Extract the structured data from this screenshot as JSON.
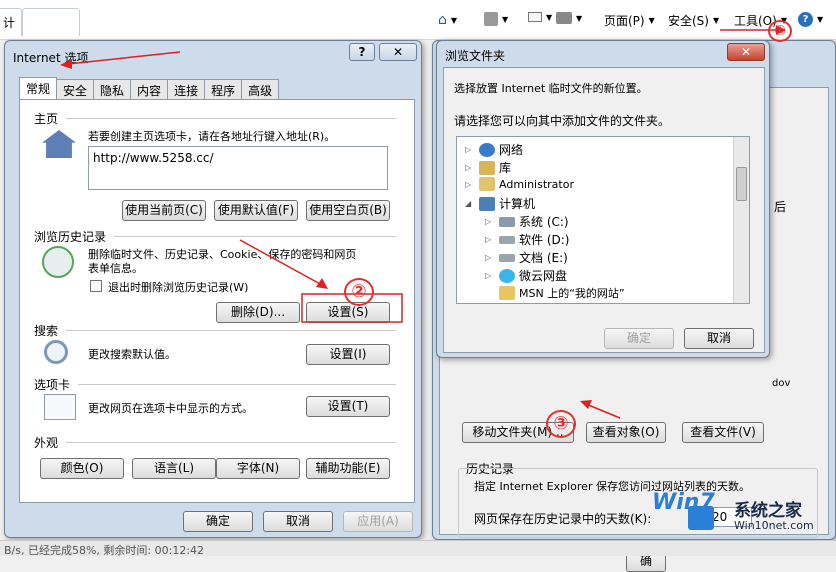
{
  "browser": {
    "tab_label": "计",
    "toolbar": {
      "page_label": "页面(P)",
      "safety_label": "安全(S)",
      "tools_label": "工具(O)"
    }
  },
  "internet_options": {
    "title": "Internet 选项",
    "tabs": [
      "常规",
      "安全",
      "隐私",
      "内容",
      "连接",
      "程序",
      "高级"
    ],
    "home": {
      "section": "主页",
      "instruction": "若要创建主页选项卡，请在各地址行键入地址(R)。",
      "url": "http://www.5258.cc/",
      "btn_current": "使用当前页(C)",
      "btn_default": "使用默认值(F)",
      "btn_blank": "使用空白页(B)"
    },
    "history": {
      "section": "浏览历史记录",
      "desc_line1": "删除临时文件、历史记录、Cookie、保存的密码和网页",
      "desc_line2": "表单信息。",
      "checkbox_label": "退出时删除浏览历史记录(W)",
      "btn_delete": "删除(D)...",
      "btn_settings": "设置(S)"
    },
    "search": {
      "section": "搜索",
      "desc": "更改搜索默认值。",
      "btn_settings": "设置(I)"
    },
    "tabs_section": {
      "section": "选项卡",
      "desc": "更改网页在选项卡中显示的方式。",
      "btn_settings": "设置(T)"
    },
    "appearance": {
      "section": "外观",
      "btn_colors": "颜色(O)",
      "btn_languages": "语言(L)",
      "btn_fonts": "字体(N)",
      "btn_accessibility": "辅助功能(E)"
    },
    "footer": {
      "ok": "确定",
      "cancel": "取消",
      "apply": "应用(A)"
    }
  },
  "browse_folder": {
    "title": "浏览文件夹",
    "line1": "选择放置 Internet 临时文件的新位置。",
    "line2": "请选择您可以向其中添加文件的文件夹。",
    "tree": [
      {
        "label": "网络",
        "icon": "network-icon"
      },
      {
        "label": "库",
        "icon": "library-icon"
      },
      {
        "label": "Administrator",
        "icon": "user-folder-icon"
      },
      {
        "label": "计算机",
        "icon": "computer-icon"
      },
      {
        "label": "系统 (C:)",
        "icon": "drive-icon"
      },
      {
        "label": "软件 (D:)",
        "icon": "drive-icon"
      },
      {
        "label": "文档 (E:)",
        "icon": "drive-icon"
      },
      {
        "label": "微云网盘",
        "icon": "cloud-icon"
      },
      {
        "label": "MSN 上的“我的网站”",
        "icon": "folder-icon"
      }
    ],
    "ok": "确定",
    "cancel": "取消"
  },
  "settings_dialog": {
    "btn_move": "移动文件夹(M)...",
    "btn_objects": "查看对象(O)",
    "btn_files": "查看文件(V)",
    "history_section": "历史记录",
    "history_desc": "指定 Internet Explorer 保存您访问过网站列表的天数。",
    "days_label": "网页保存在历史记录中的天数(K):",
    "days_value": "20",
    "partial_right": "后",
    "partial_right2": "dov"
  },
  "status_bar": {
    "text": "B/s, 已经完成58%, 剩余时间: 00:12:42"
  },
  "watermark": {
    "win7": "Win7",
    "site_name": "系统之家",
    "site_url": "Win10net.com"
  },
  "annotations": [
    "①",
    "②",
    "③"
  ]
}
